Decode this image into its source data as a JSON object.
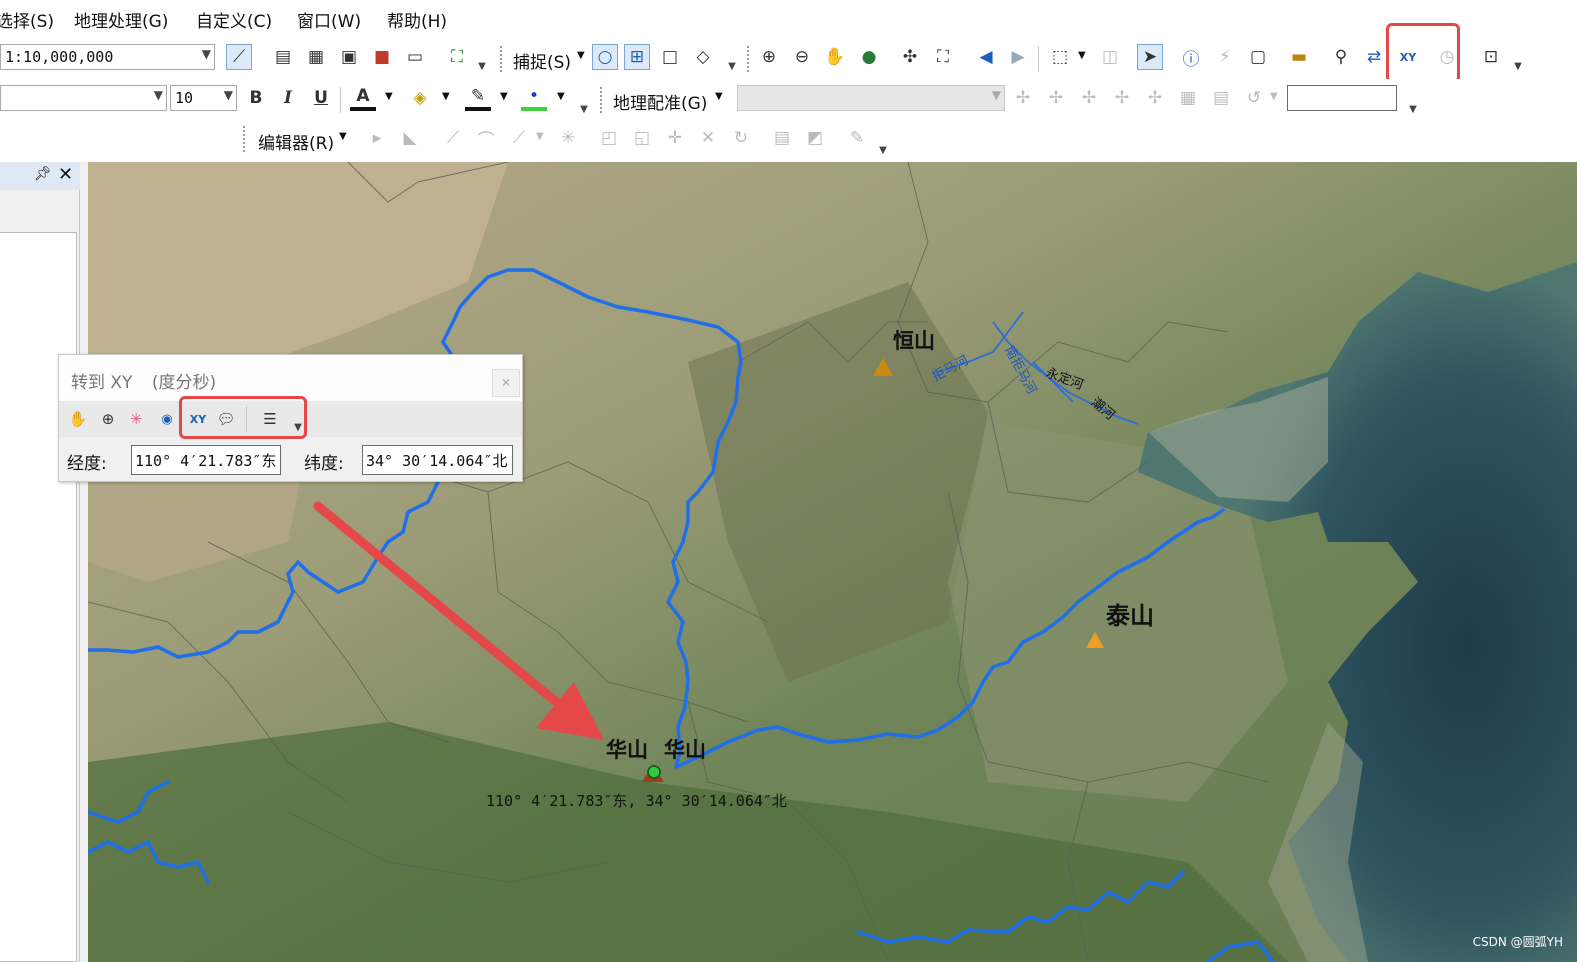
{
  "menubar": {
    "items": [
      "选择(S)",
      "地理处理(G)",
      "自定义(C)",
      "窗口(W)",
      "帮助(H)"
    ]
  },
  "toolbar1": {
    "scale": "1:10,000,000",
    "snapping_label": "捕捉(S)"
  },
  "toolbar2": {
    "font_name": "",
    "font_size": "10",
    "bold": "B",
    "italic": "I",
    "underline": "U",
    "georef_label": "地理配准(G)"
  },
  "toolbar3": {
    "editor_label": "编辑器(R)"
  },
  "dialog": {
    "title": "转到 XY",
    "units": "(度分秒)",
    "lon_label": "经度:",
    "lon_value": "110° 4′21.783″东",
    "lat_label": "纬度:",
    "lat_value": "34° 30′14.064″北"
  },
  "map": {
    "labels": {
      "hengshan": "恒山",
      "taishan": "泰山",
      "huashan_a": "华山",
      "huashan_b": "华山",
      "coord": "110° 4′21.783″东, 34° 30′14.064″北",
      "river1": "拒马河",
      "river2": "南拒马河",
      "river3": "永定河",
      "river4": "潮河"
    },
    "colors": {
      "river": "#1f6fe8",
      "peak": "#c98a10",
      "arrow": "#e54848",
      "marker": "#2ecc40"
    }
  },
  "watermark": "CSDN @圆弧YH"
}
